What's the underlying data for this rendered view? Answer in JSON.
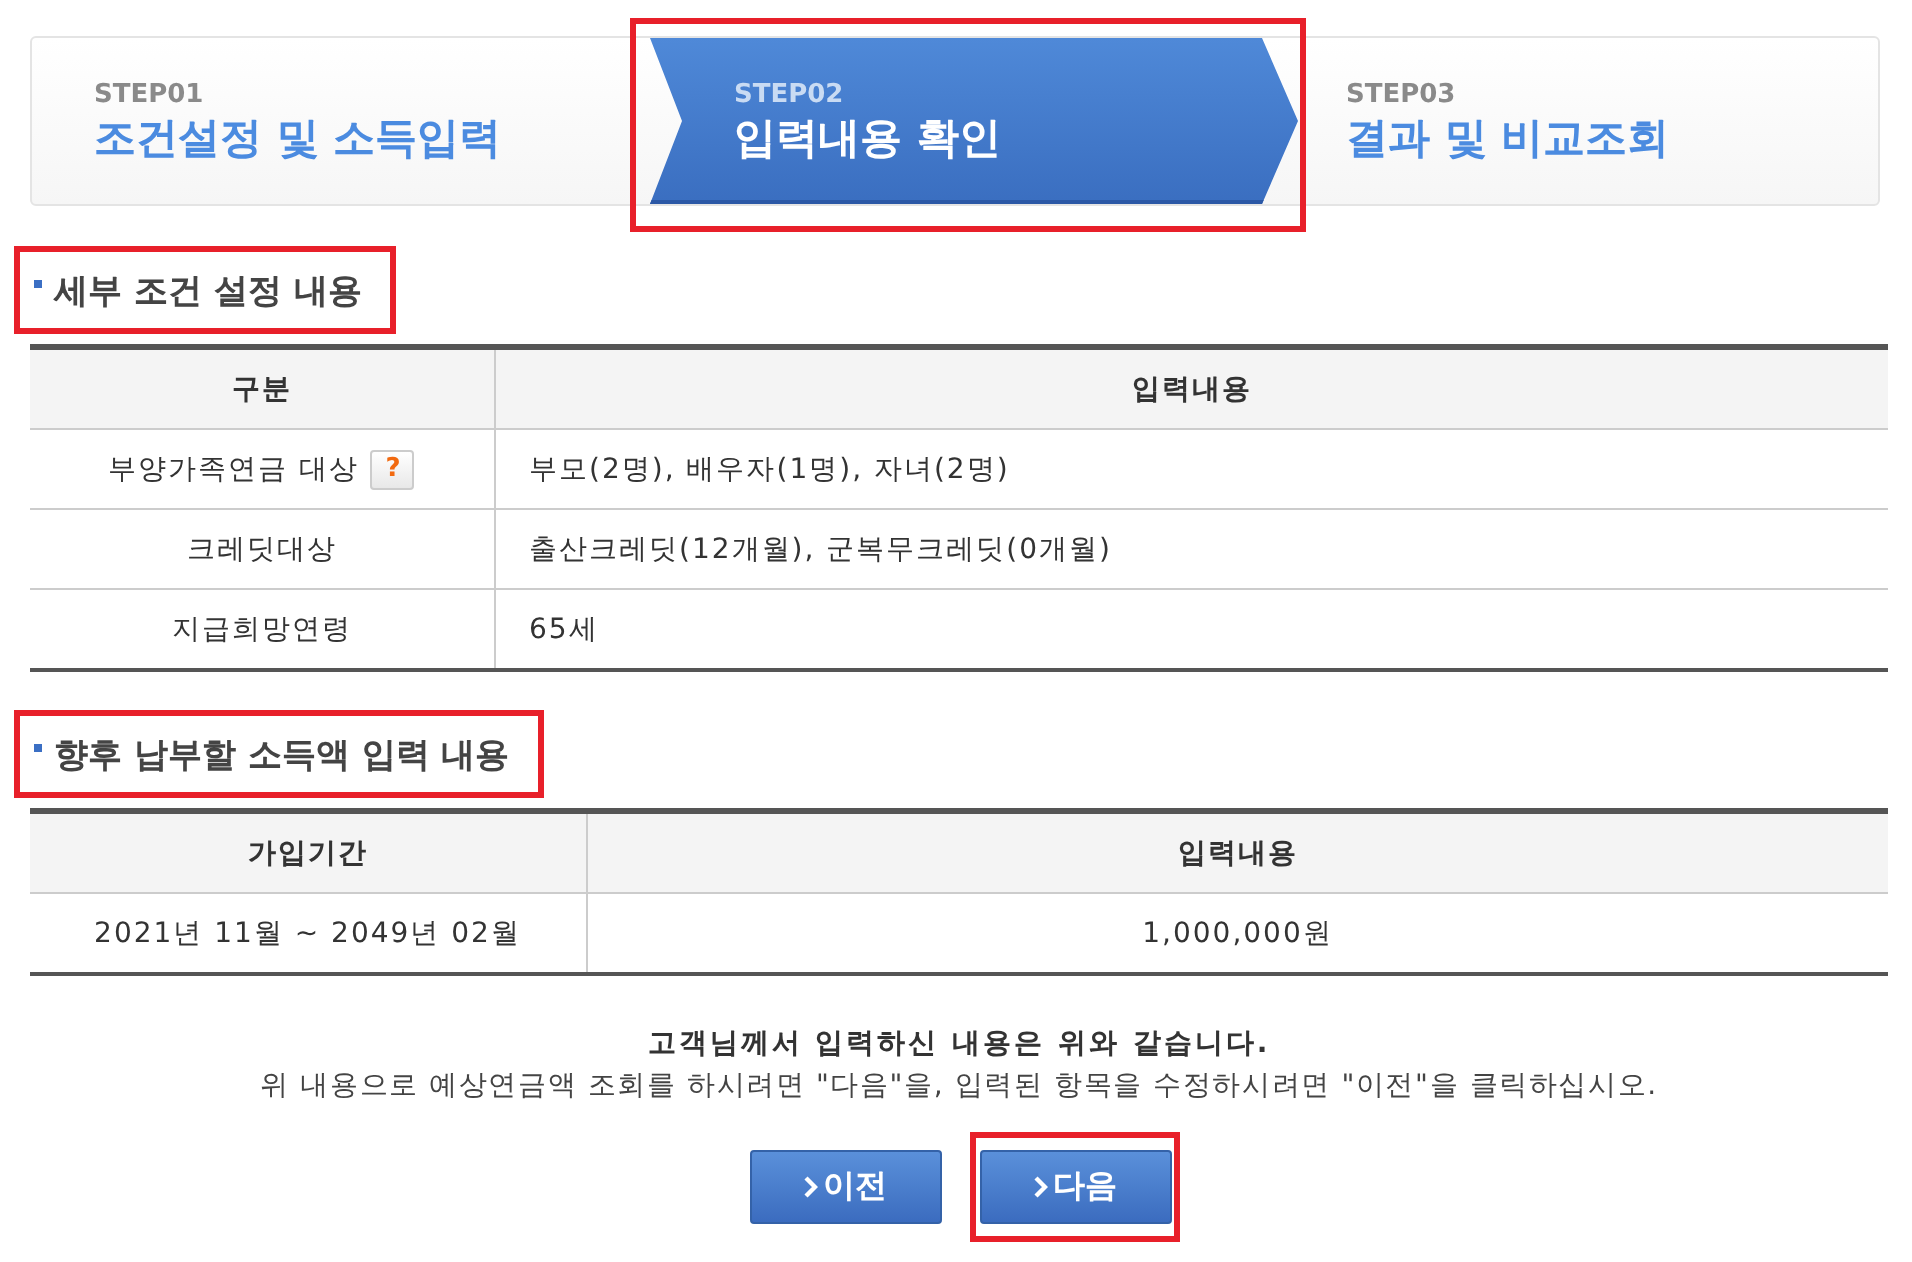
{
  "steps": [
    {
      "number": "STEP01",
      "title": "조건설정 및 소득입력",
      "selected": false,
      "highlighted": false
    },
    {
      "number": "STEP02",
      "title": "입력내용 확인",
      "selected": true,
      "highlighted": true
    },
    {
      "number": "STEP03",
      "title": "결과 및 비교조회",
      "selected": false,
      "highlighted": false
    }
  ],
  "sections": [
    {
      "title": "세부 조건 설정 내용",
      "highlighted": true,
      "table": {
        "columns": [
          "구분",
          "입력내용"
        ],
        "rows": [
          {
            "cells": [
              "부양가족연금 대상",
              "부모(2명), 배우자(1명), 자녀(2명)"
            ],
            "help": "?"
          },
          {
            "cells": [
              "크레딧대상",
              "출산크레딧(12개월), 군복무크레딧(0개월)"
            ]
          },
          {
            "cells": [
              "지급희망연령",
              "65세"
            ]
          }
        ]
      }
    },
    {
      "title": "향후 납부할 소득액 입력 내용",
      "highlighted": true,
      "table": {
        "columns": [
          "가입기간",
          "입력내용"
        ],
        "rows": [
          {
            "cells": [
              "2021년 11월 ~ 2049년 02월",
              "1,000,000원"
            ]
          }
        ]
      }
    }
  ],
  "notice": {
    "heading": "고객님께서 입력하신 내용은 위와 같습니다.",
    "text": "위 내용으로 예상연금액 조회를 하시려면 \"다음\"을, 입력된 항목을 수정하시려면 \"이전\"을 클릭하십시오."
  },
  "buttons": [
    {
      "label": "이전",
      "highlighted": false
    },
    {
      "label": "다음",
      "highlighted": true
    }
  ]
}
